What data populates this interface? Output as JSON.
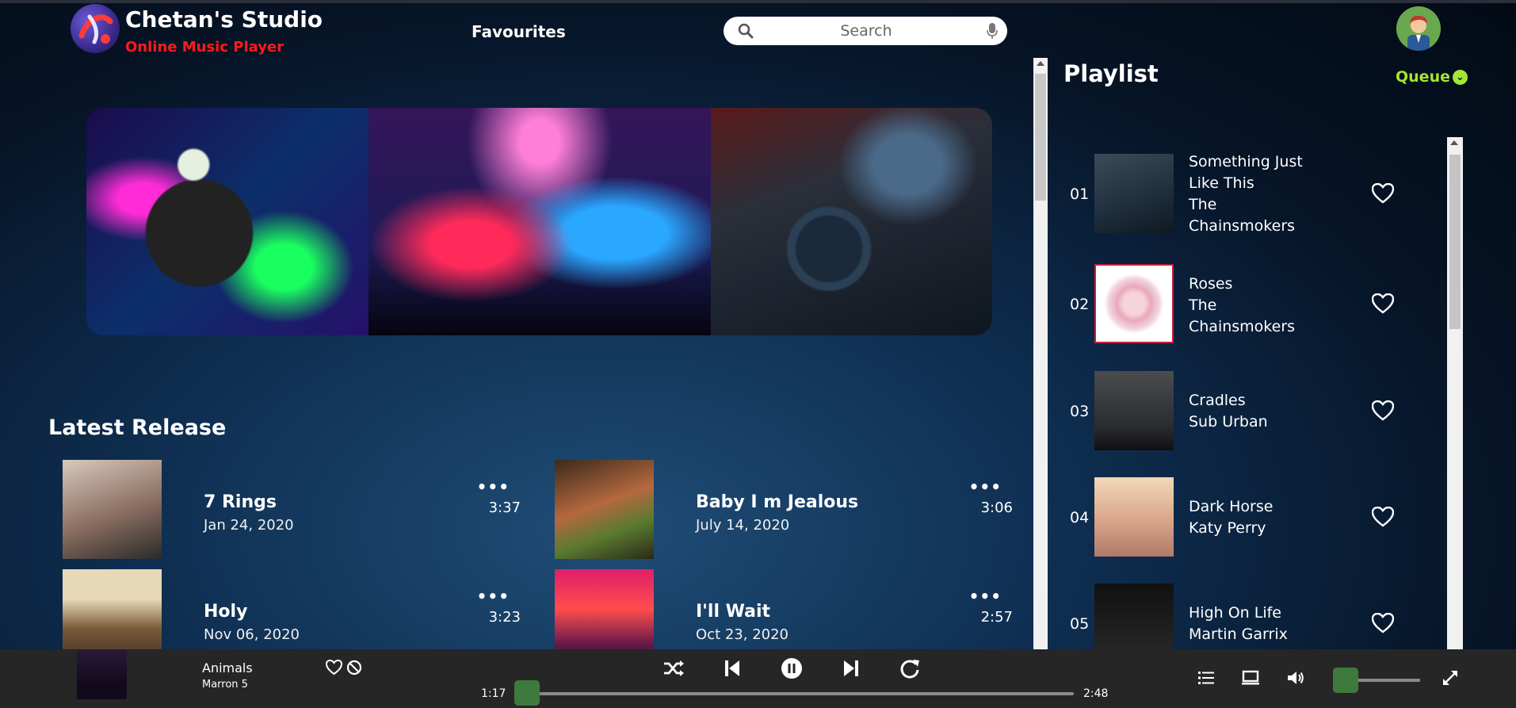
{
  "header": {
    "brand_name": "Chetan's Studio",
    "brand_sub": "Online Music Player",
    "nav_favourites": "Favourites",
    "search_placeholder": "Search"
  },
  "latest": {
    "title": "Latest Release",
    "songs": [
      {
        "title": "7 Rings",
        "date": "Jan 24, 2020",
        "duration": "3:37",
        "more": "•••"
      },
      {
        "title": "Baby I m Jealous",
        "date": "July 14, 2020",
        "duration": "3:06",
        "more": "•••"
      },
      {
        "title": "Holy",
        "date": "Nov 06, 2020",
        "duration": "3:23",
        "more": "•••"
      },
      {
        "title": "I'll Wait",
        "date": "Oct 23, 2020",
        "duration": "2:57",
        "more": "•••"
      }
    ]
  },
  "playlist": {
    "title": "Playlist",
    "queue_label": "Queue",
    "items": [
      {
        "num": "01",
        "line1": "Something Just",
        "line2": "Like This",
        "line3": "The",
        "line4": "Chainsmokers"
      },
      {
        "num": "02",
        "line1": "Roses",
        "line2": "The",
        "line3": "Chainsmokers",
        "line4": ""
      },
      {
        "num": "03",
        "line1": "Cradles",
        "line2": "Sub Urban",
        "line3": "",
        "line4": ""
      },
      {
        "num": "04",
        "line1": "Dark Horse",
        "line2": "Katy Perry",
        "line3": "",
        "line4": ""
      },
      {
        "num": "05",
        "line1": "High On Life",
        "line2": "Martin Garrix",
        "line3": "",
        "line4": ""
      }
    ]
  },
  "player": {
    "now_playing_title": "Animals",
    "now_playing_artist": "Marron 5",
    "elapsed": "1:17",
    "total": "2:48",
    "progress_fraction": 0.0,
    "volume_fraction": 0.0
  },
  "colors": {
    "accent_green": "#a3e635",
    "brand_red": "#ff1a1a",
    "knob_green": "#3e7a3e",
    "player_bar": "#262626"
  },
  "icons": [
    "logo-icon",
    "search-icon",
    "mic-icon",
    "avatar-icon",
    "heart-icon",
    "block-icon",
    "shuffle-icon",
    "previous-icon",
    "pause-icon",
    "next-icon",
    "repeat-icon",
    "queue-list-icon",
    "device-icon",
    "volume-icon",
    "fullscreen-icon",
    "chevron-down-icon",
    "more-icon"
  ]
}
